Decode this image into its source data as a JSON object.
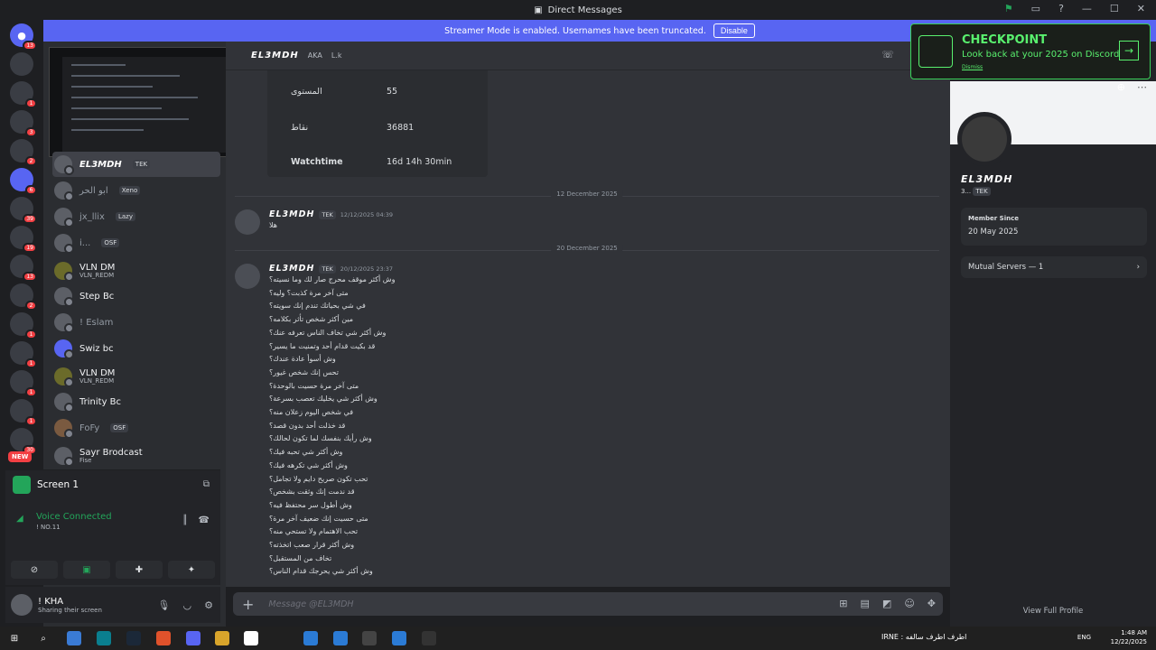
{
  "window": {
    "title": "Direct Messages"
  },
  "banner": {
    "text": "Streamer Mode is enabled. Usernames have been truncated.",
    "button": "Disable"
  },
  "guild_badges": [
    "13",
    "1",
    "3",
    "2",
    "6",
    "39",
    "19",
    "13",
    "2",
    "1",
    "1",
    "1",
    "1",
    "30"
  ],
  "guild_new": "NEW",
  "dms": [
    {
      "name": "EL3MDH",
      "tag": "TEK",
      "sub": ""
    },
    {
      "name": "ابو الحر",
      "tag": "Xeno",
      "sub": ""
    },
    {
      "name": "jx_llix",
      "tag": "Lazy",
      "sub": ""
    },
    {
      "name": "i...",
      "tag": "OSF",
      "sub": ""
    },
    {
      "name": "VLN DM",
      "tag": "",
      "sub": "VLN_REDM"
    },
    {
      "name": "Step Bc",
      "tag": "",
      "sub": ""
    },
    {
      "name": "! Eslam",
      "tag": "",
      "sub": ""
    },
    {
      "name": "Swiz bc",
      "tag": "",
      "sub": ""
    },
    {
      "name": "VLN DM",
      "tag": "",
      "sub": "VLN_REDM"
    },
    {
      "name": "Trinity Bc",
      "tag": "",
      "sub": ""
    },
    {
      "name": "FoFy",
      "tag": "OSF",
      "sub": ""
    },
    {
      "name": "Sayr Brodcast",
      "tag": "",
      "sub": "Fise"
    }
  ],
  "voice": {
    "screen_label": "Screen 1",
    "status": "Voice Connected",
    "channel": "! NO.11"
  },
  "user": {
    "name": "! KHA",
    "status": "Sharing their screen"
  },
  "header": {
    "name": "EL3MDH",
    "aka_label": "AKA",
    "aka_value": "L.k"
  },
  "embed": {
    "rows": [
      {
        "label": "المستوى",
        "value": "55"
      },
      {
        "label": "نقاط",
        "value": "36881"
      },
      {
        "label": "Watchtime",
        "value": "16d 14h 30min"
      }
    ]
  },
  "dividers": [
    "12 December 2025",
    "20 December 2025"
  ],
  "messages": [
    {
      "author": "EL3MDH",
      "tag": "TEK",
      "time": "12/12/2025 04:39",
      "lines": [
        "هلا"
      ]
    },
    {
      "author": "EL3MDH",
      "tag": "TEK",
      "time": "20/12/2025 23:37",
      "lines": [
        "وش أكثر موقف محرج صار لك وما نسيته؟",
        "متى آخر مرة كذبت؟ وليه؟",
        "في شي بحياتك تندم إنك سويته؟",
        "مين أكثر شخص تأثر بكلامه؟",
        "وش أكثر شي تخاف الناس تعرفه عنك؟",
        "قد بكيت قدام أحد وتمنيت ما يسير؟",
        "وش أسوأ عادة عندك؟",
        "تحس إنك شخص غيور؟",
        "متى آخر مرة حسيت بالوحدة؟",
        "وش أكثر شي يخليك تعصب بسرعة؟",
        "في شخص اليوم زعلان منه؟",
        "قد خذلت أحد بدون قصد؟",
        "وش رأيك بنفسك لما تكون لحالك؟",
        "وش أكثر شي تحبه فيك؟",
        "وش أكثر شي تكرهه فيك؟",
        "تحب تكون صريح دايم ولا تجامل؟",
        "قد ندمت إنك وثقت بشخص؟",
        "وش أطول سر محتفظ فيه؟",
        "متى حسيت إنك ضعيف آخر مرة؟",
        "تحب الاهتمام ولا تستحي منه؟",
        "وش أكثر قرار صعب اتخذته؟",
        "تخاف من المستقبل؟",
        "وش أكثر شي يحرجك قدام الناس؟"
      ]
    }
  ],
  "composer": {
    "placeholder": "Message @EL3MDH"
  },
  "profile": {
    "name": "EL3MDH",
    "sub": "3...",
    "tag": "TEK",
    "member_since_label": "Member Since",
    "member_since_value": "20 May 2025",
    "mutual_servers": "Mutual Servers — 1",
    "view_full": "View Full Profile"
  },
  "checkpoint": {
    "title": "CHECKPOINT",
    "subtitle": "Look back at your 2025 on Discord",
    "dismiss": "Dismiss"
  },
  "taskbar": {
    "news": "IRNE : اطرف اطرف سالفه",
    "lang": "ENG",
    "time": "1:48 AM",
    "date": "12/22/2025"
  }
}
